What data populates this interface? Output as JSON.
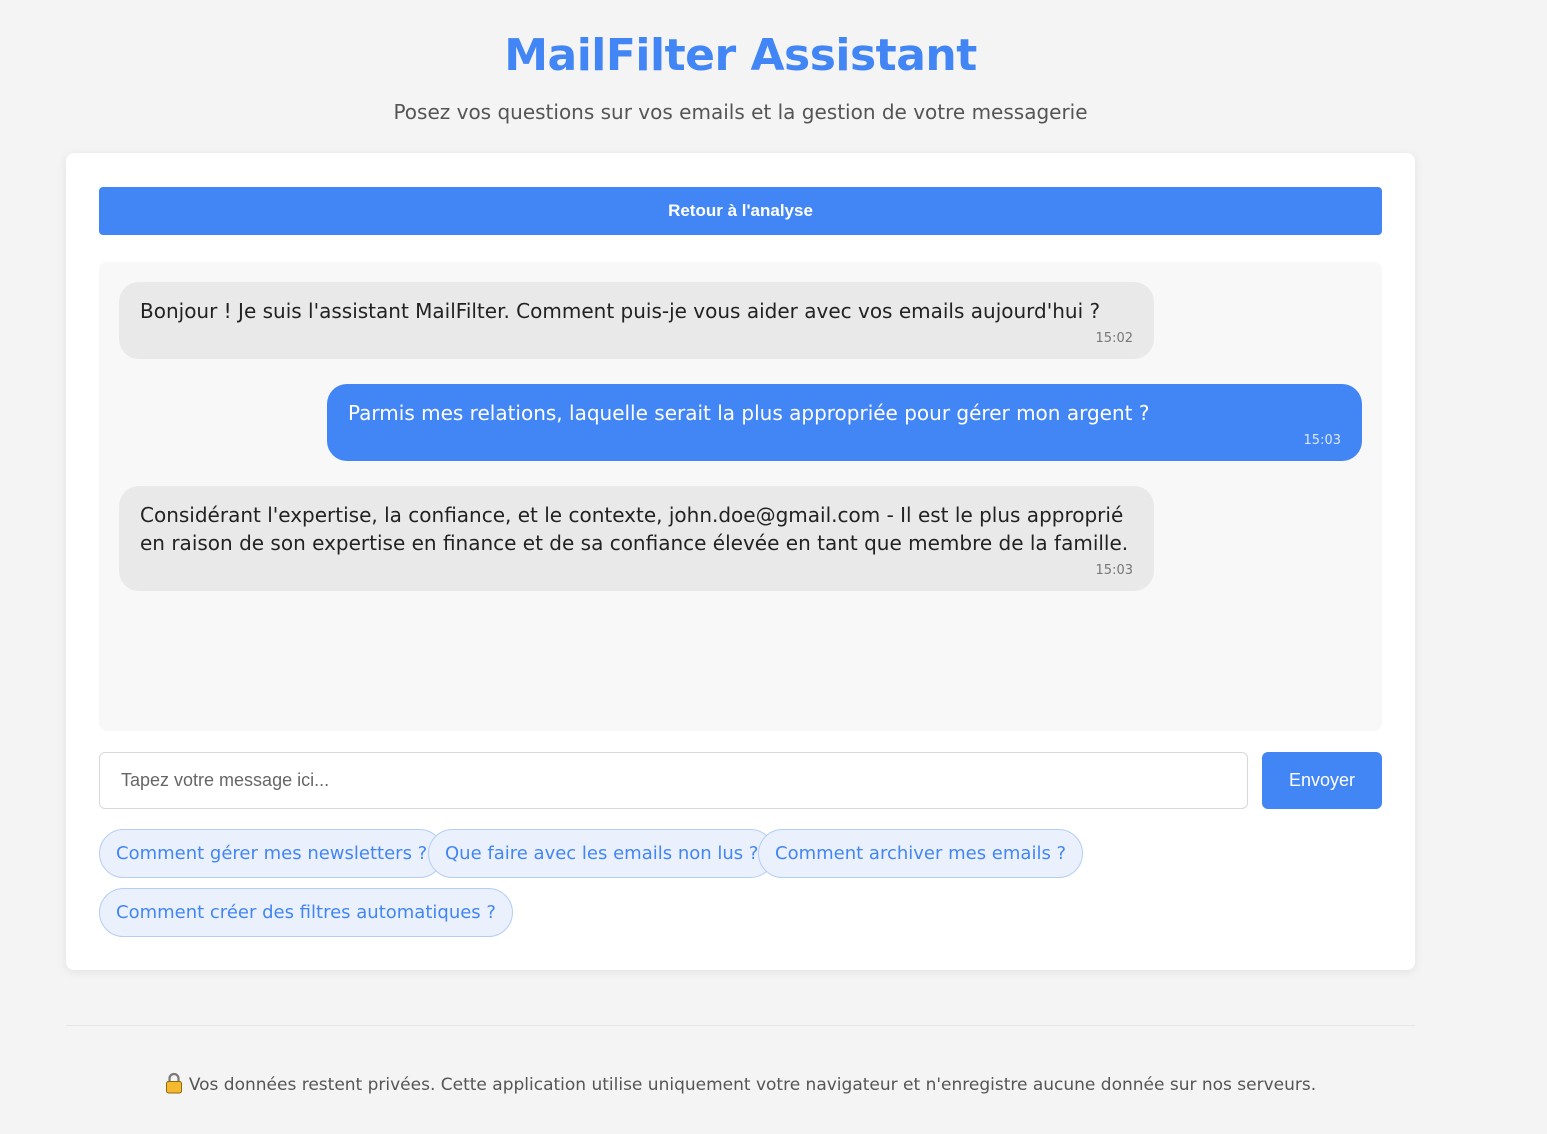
{
  "header": {
    "title": "MailFilter Assistant",
    "subtitle": "Posez vos questions sur vos emails et la gestion de votre messagerie"
  },
  "back_button_label": "Retour à l'analyse",
  "messages": [
    {
      "role": "bot",
      "text": "Bonjour ! Je suis l'assistant MailFilter. Comment puis-je vous aider avec vos emails aujourd'hui ?",
      "time": "15:02"
    },
    {
      "role": "user",
      "text": "Parmis mes relations, laquelle serait la plus appropriée pour gérer mon argent ?",
      "time": "15:03"
    },
    {
      "role": "bot",
      "text": "Considérant l'expertise, la confiance, et le contexte, john.doe@gmail.com - Il est le plus approprié en raison de son expertise en finance et de sa confiance élevée en tant que membre de la famille.",
      "time": "15:03"
    }
  ],
  "input": {
    "placeholder": "Tapez votre message ici...",
    "value": ""
  },
  "send_button_label": "Envoyer",
  "suggestions": [
    "Comment gérer mes newsletters ?",
    "Que faire avec les emails non lus ?",
    "Comment archiver mes emails ?",
    "Comment créer des filtres automatiques ?"
  ],
  "footer": {
    "icon": "lock-icon",
    "text": "Vos données restent privées. Cette application utilise uniquement votre navigateur et n'enregistre aucune donnée sur nos serveurs."
  },
  "colors": {
    "accent": "#4285f4",
    "page_background": "#f4f4f4",
    "bot_bubble": "#e9e9e9",
    "chip_background": "#eaf1fd"
  }
}
